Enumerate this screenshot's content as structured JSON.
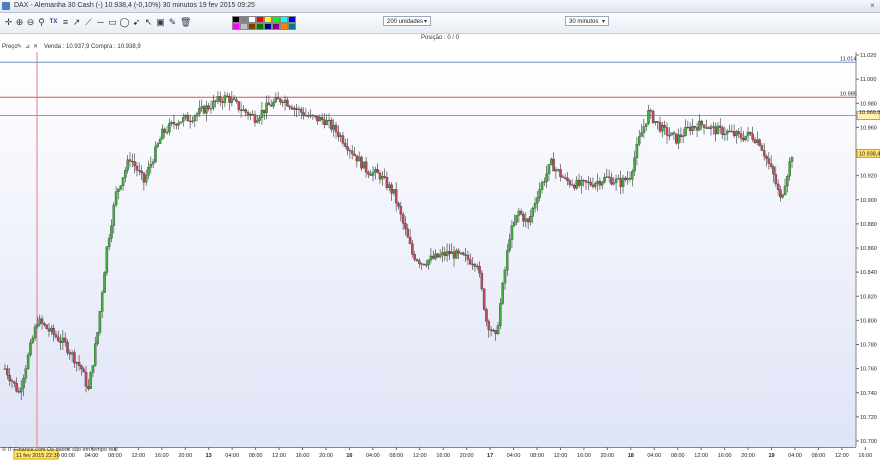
{
  "window": {
    "title": "DAX - Alemanha 30 Cash (-)    10.938,4 (-0,10%)    30 minutos  19 fev 2015 09:25",
    "close_icon": "×"
  },
  "toolbar": {
    "quantity_combo": "200 unidades",
    "timeframe_combo": "30 minutos",
    "icons": [
      "crosshair-icon",
      "zoom-in-icon",
      "zoom-out-icon",
      "magnify-icon",
      "text-tool-icon",
      "fibonacci-icon",
      "trendline-icon",
      "ray-icon",
      "hline-icon",
      "rectangle-icon",
      "ellipse-icon",
      "arrow-icon",
      "cursor-icon",
      "lock-icon",
      "trash-icon",
      "pencil-icon"
    ],
    "palette": [
      "#000000",
      "#7f7f7f",
      "#ffffff",
      "#ff0000",
      "#ffff00",
      "#00ff00",
      "#00ffff",
      "#0000ff",
      "#ff00ff",
      "#c0c0c0",
      "#804000",
      "#008000",
      "#000080",
      "#800080",
      "#ff8000",
      "#008080"
    ]
  },
  "position_bar": {
    "label": "Posição : 0",
    "suffix": " / ",
    "value": "0"
  },
  "price_bar": {
    "label": "Preço",
    "quote": "Venda : 10.937,9 Compra : 10.938,9"
  },
  "copyright": "© IT-Finance.com Os dados são em tempo real",
  "chart_data": {
    "type": "candlestick",
    "ylim": [
      10700,
      11030
    ],
    "y_ticks": [
      10700,
      10720,
      10740,
      10760,
      10780,
      10800,
      10820,
      10840,
      10860,
      10880,
      10900,
      10920,
      10940,
      10960,
      10980,
      11000,
      11020
    ],
    "y_tick_labels": [
      "10.700",
      "10.720",
      "10.740",
      "10.760",
      "10.780",
      "10.800",
      "10.820",
      "10.840",
      "10.860",
      "10.880",
      "10.900",
      "10.920",
      "10.940",
      "10.960",
      "10.980",
      "11.000",
      "11.020"
    ],
    "x_tick_labels": [
      "00:00",
      "04:00",
      "08:00",
      "12:00",
      "16:00",
      "20:00",
      "13",
      "04:00",
      "08:00",
      "12:00",
      "16:00",
      "20:00",
      "16",
      "04:00",
      "08:00",
      "12:00",
      "16:00",
      "20:00",
      "17",
      "04:00",
      "08:00",
      "12:00",
      "16:00",
      "20:00",
      "18",
      "04:00",
      "08:00",
      "12:00",
      "16:00",
      "20:00",
      "19",
      "04:00",
      "08:00",
      "12:00",
      "16:00"
    ],
    "x_bold": [
      "13",
      "16",
      "17",
      "18",
      "19"
    ],
    "current_time_label": "11 fev 2015 22:30",
    "horizontal_lines": [
      {
        "value": 11014,
        "label": "11.014",
        "color": "#6f8fbf"
      },
      {
        "value": 10985,
        "label": "10.985",
        "color": "#e05050"
      },
      {
        "value": 10969.8,
        "label": "10.969,8",
        "color": "#e08080",
        "boxed": true
      }
    ],
    "last_price": {
      "value": 10938.4,
      "label": "10.938,4"
    },
    "anchors": [
      [
        0,
        10760
      ],
      [
        6,
        10740
      ],
      [
        14,
        10800
      ],
      [
        20,
        10790
      ],
      [
        26,
        10780
      ],
      [
        33,
        10760
      ],
      [
        36,
        10742
      ],
      [
        40,
        10790
      ],
      [
        44,
        10860
      ],
      [
        48,
        10905
      ],
      [
        54,
        10935
      ],
      [
        60,
        10915
      ],
      [
        68,
        10955
      ],
      [
        74,
        10965
      ],
      [
        80,
        10968
      ],
      [
        86,
        10975
      ],
      [
        92,
        10982
      ],
      [
        96,
        10985
      ],
      [
        102,
        10975
      ],
      [
        108,
        10968
      ],
      [
        114,
        10978
      ],
      [
        120,
        10984
      ],
      [
        126,
        10975
      ],
      [
        132,
        10968
      ],
      [
        138,
        10966
      ],
      [
        144,
        10955
      ],
      [
        150,
        10940
      ],
      [
        156,
        10925
      ],
      [
        162,
        10920
      ],
      [
        168,
        10905
      ],
      [
        172,
        10880
      ],
      [
        176,
        10855
      ],
      [
        180,
        10848
      ],
      [
        186,
        10852
      ],
      [
        192,
        10856
      ],
      [
        198,
        10852
      ],
      [
        204,
        10848
      ],
      [
        208,
        10800
      ],
      [
        212,
        10785
      ],
      [
        218,
        10870
      ],
      [
        222,
        10890
      ],
      [
        226,
        10880
      ],
      [
        230,
        10905
      ],
      [
        236,
        10930
      ],
      [
        242,
        10916
      ],
      [
        248,
        10912
      ],
      [
        254,
        10914
      ],
      [
        260,
        10918
      ],
      [
        266,
        10914
      ],
      [
        270,
        10920
      ],
      [
        274,
        10950
      ],
      [
        278,
        10972
      ],
      [
        284,
        10958
      ],
      [
        290,
        10950
      ],
      [
        296,
        10960
      ],
      [
        302,
        10963
      ],
      [
        306,
        10958
      ],
      [
        312,
        10956
      ],
      [
        318,
        10952
      ],
      [
        322,
        10954
      ],
      [
        326,
        10948
      ],
      [
        332,
        10920
      ],
      [
        335,
        10900
      ],
      [
        337,
        10915
      ],
      [
        340,
        10938
      ]
    ]
  }
}
